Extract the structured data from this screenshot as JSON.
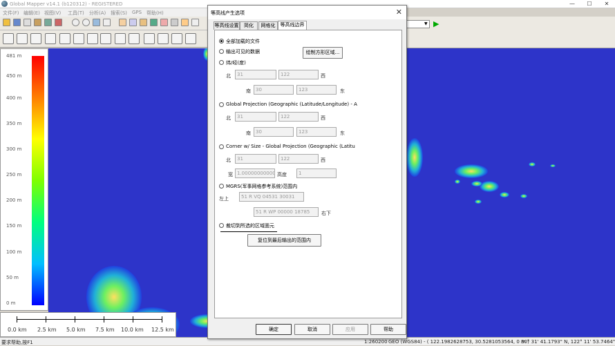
{
  "app": {
    "title": "Global Mapper v14.1 (b120312) - REGISTERED",
    "window_controls": {
      "minimize": "—",
      "maximize": "☐",
      "close": "✕"
    }
  },
  "menu": [
    "文件(F)",
    "编辑(E)",
    "视图(V)",
    "工具(T)",
    "分析(A)",
    "搜索(S)",
    "GPS",
    "帮助(H)"
  ],
  "legend": {
    "labels": [
      "481 m",
      "450 m",
      "400 m",
      "350 m",
      "300 m",
      "250 m",
      "200 m",
      "150 m",
      "100 m",
      "50 m",
      "0 m"
    ],
    "colors": [
      "#ff0000",
      "#ff7f00",
      "#ffff00",
      "#7fff00",
      "#00ff7f",
      "#00bfff",
      "#0000ff"
    ]
  },
  "scalebar": {
    "labels": [
      "0.0 km",
      "2.5 km",
      "5.0 km",
      "7.5 km",
      "10.0 km",
      "12.5 km"
    ]
  },
  "status": {
    "left": "要求帮助,按F1",
    "scale": "1:260200",
    "projection": "GEO (WGS84) - ( 122.1982628753, 30.5281053564, 0 m )",
    "coords": "30° 31' 41.1793\" N, 122° 11' 53.7464\" E"
  },
  "dialog": {
    "title": "等高线产生选项",
    "close": "✕",
    "tabs": [
      "等高线设置",
      "简化",
      "网格化",
      "等高线边界"
    ],
    "options": {
      "all_loaded": "全部加载的文件",
      "visible": "输出可见的数据",
      "draw_box": "绘制方形区域...",
      "latlon": "纬/经(度)",
      "global_proj": "Global Projection (Geographic (Latitude/Longitude) - A",
      "corner_size": "Corner w/ Size - Global Projection (Geographic (Latitu",
      "mgrs": "MGRS(军事网格参考系统)范围内",
      "crop_area": "裁切到所选的区域面元",
      "reset_button": "复位到最后输出的范围内"
    },
    "labels": {
      "north": "北",
      "south": "南",
      "west": "西",
      "east": "东",
      "width": "宽",
      "height": "高度",
      "top_left": "左上",
      "bottom_right": "右下"
    },
    "fields": {
      "latlon": {
        "north": "31",
        "west": "122",
        "south": "30",
        "east": "123"
      },
      "global": {
        "north": "31",
        "west": "122",
        "south": "30",
        "east": "123"
      },
      "corner": {
        "north": "31",
        "west": "122",
        "width": "1.000000000000",
        "height": "1"
      },
      "mgrs": {
        "top_left": "51 R VQ 04531 30031",
        "bottom_right": "51 R WP 00000 18785"
      }
    },
    "buttons": {
      "ok": "确定",
      "cancel": "取消",
      "apply": "应用",
      "help": "帮助"
    }
  }
}
